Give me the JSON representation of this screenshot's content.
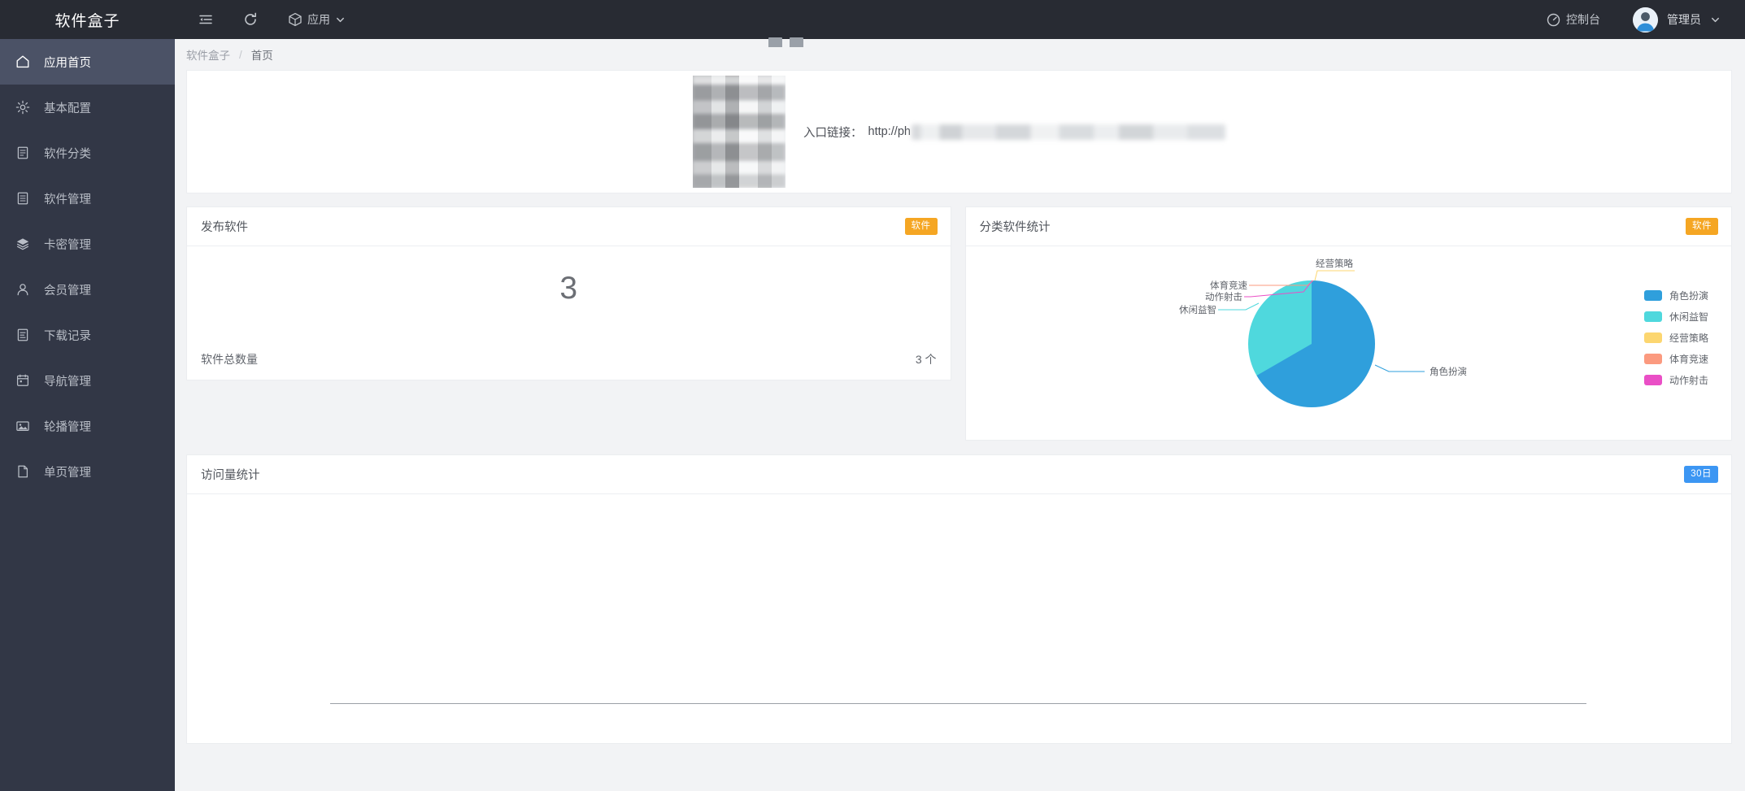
{
  "header": {
    "logo": "软件盒子",
    "tools": [
      {
        "name": "collapse-sidebar",
        "label": "",
        "icon": "collapse-icon"
      },
      {
        "name": "refresh",
        "label": "",
        "icon": "refresh-icon"
      },
      {
        "name": "apps-menu",
        "label": "应用",
        "icon": "cube-icon"
      }
    ],
    "console_label": "控制台",
    "user_label": "管理员"
  },
  "sidebar": {
    "items": [
      {
        "label": "应用首页",
        "icon": "home-icon",
        "active": true
      },
      {
        "label": "基本配置",
        "icon": "gear-icon",
        "active": false
      },
      {
        "label": "软件分类",
        "icon": "list-icon",
        "active": false
      },
      {
        "label": "软件管理",
        "icon": "doc-icon",
        "active": false
      },
      {
        "label": "卡密管理",
        "icon": "layers-icon",
        "active": false
      },
      {
        "label": "会员管理",
        "icon": "user-icon",
        "active": false
      },
      {
        "label": "下载记录",
        "icon": "record-icon",
        "active": false
      },
      {
        "label": "导航管理",
        "icon": "calendar-icon",
        "active": false
      },
      {
        "label": "轮播管理",
        "icon": "image-icon",
        "active": false
      },
      {
        "label": "单页管理",
        "icon": "page-icon",
        "active": false
      }
    ]
  },
  "breadcrumb": {
    "root": "软件盒子",
    "separator": "/",
    "current": "首页"
  },
  "entry": {
    "label": "入口链接：",
    "url_visible": "http://ph",
    "url_redacted": true,
    "qrcode_name": "entry-qrcode"
  },
  "cards": {
    "publish": {
      "title": "发布软件",
      "badge": "软件",
      "big_number": "3",
      "total_label": "软件总数量",
      "total_value": "3 个"
    },
    "pie": {
      "title": "分类软件统计",
      "badge": "软件"
    },
    "visits": {
      "title": "访问量统计",
      "badge": "30日"
    }
  },
  "chart_data": [
    {
      "type": "pie",
      "title": "分类软件统计",
      "categories": [
        "角色扮演",
        "休闲益智",
        "经营策略",
        "体育竞速",
        "动作射击"
      ],
      "values": [
        2,
        1,
        0,
        0,
        0
      ],
      "percentages": [
        66.7,
        33.3,
        0,
        0,
        0
      ],
      "colors": [
        "#2f9fdc",
        "#4fd8dd",
        "#fcd670",
        "#fb9a7f",
        "#ea4fc6"
      ],
      "labels_outside": [
        "经营策略",
        "体育竞速",
        "动作射击",
        "休闲益智",
        "角色扮演"
      ],
      "legend": {
        "position": "right",
        "entries": [
          {
            "label": "角色扮演",
            "color": "#2f9fdc"
          },
          {
            "label": "休闲益智",
            "color": "#4fd8dd"
          },
          {
            "label": "经营策略",
            "color": "#fcd670"
          },
          {
            "label": "体育竞速",
            "color": "#fb9a7f"
          },
          {
            "label": "动作射击",
            "color": "#ea4fc6"
          }
        ]
      }
    },
    {
      "type": "line",
      "title": "访问量统计",
      "range_label": "30日",
      "x": [],
      "values": [],
      "xlabel": "",
      "ylabel": "",
      "grid": false,
      "empty": true
    }
  ]
}
